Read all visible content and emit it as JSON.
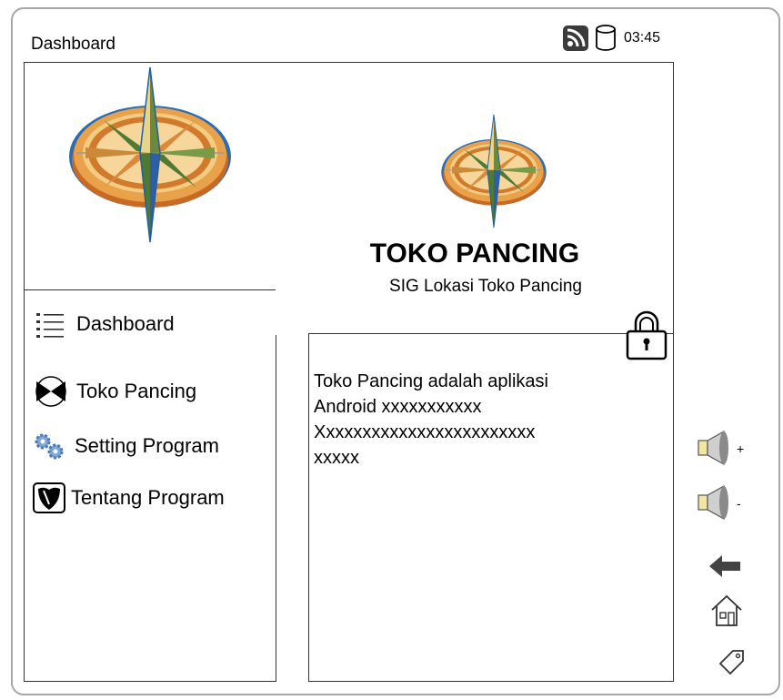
{
  "header": {
    "title": "Dashboard",
    "time": "03:45",
    "status_icons": [
      "rss-icon",
      "database-icon"
    ]
  },
  "brand": {
    "name": "TOKO PANCING",
    "subtitle": "SIG Lokasi Toko Pancing"
  },
  "menu": [
    {
      "label": "Dashboard",
      "icon": "list-icon"
    },
    {
      "label": "Toko Pancing",
      "icon": "store-icon"
    },
    {
      "label": "Setting Program",
      "icon": "gears-icon"
    },
    {
      "label": "Tentang Program",
      "icon": "shield-icon"
    }
  ],
  "about": {
    "lines": [
      "Toko Pancing adalah aplikasi",
      "Android xxxxxxxxxxx",
      "Xxxxxxxxxxxxxxxxxxxxxxxx",
      "xxxxx"
    ]
  },
  "side_buttons": [
    {
      "icon": "volume-up-icon",
      "mark": "+"
    },
    {
      "icon": "volume-down-icon",
      "mark": "-"
    },
    {
      "icon": "back-arrow-icon"
    },
    {
      "icon": "home-icon"
    },
    {
      "icon": "tag-icon"
    }
  ],
  "colors": {
    "border": "#a7a7a7",
    "compass_ring": "#1f5fa8",
    "compass_fill": "#d9893a"
  }
}
